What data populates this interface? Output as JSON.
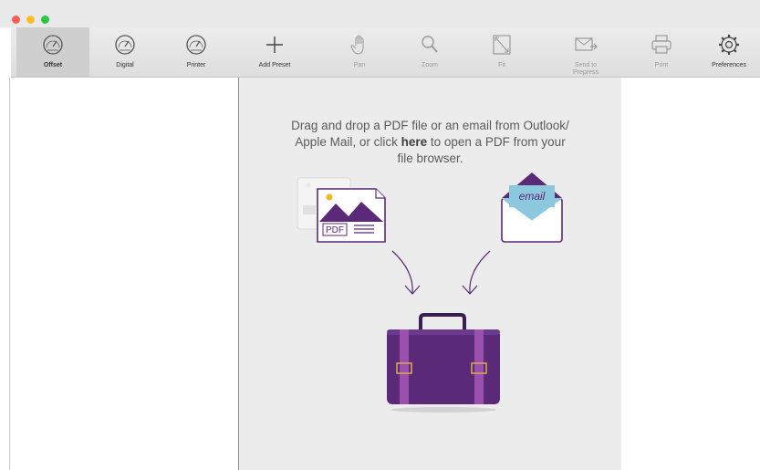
{
  "window": {
    "traffic_lights": [
      "close",
      "minimize",
      "zoom"
    ]
  },
  "toolbar": {
    "items": [
      {
        "label": "Offset",
        "icon": "gauge-icon",
        "selected": true,
        "enabled": true
      },
      {
        "label": "Digital",
        "icon": "gauge-icon",
        "selected": false,
        "enabled": true
      },
      {
        "label": "Printer",
        "icon": "gauge-icon",
        "selected": false,
        "enabled": true
      },
      {
        "label": "Add Preset",
        "icon": "plus-icon",
        "selected": false,
        "enabled": true
      },
      {
        "label": "Pan",
        "icon": "hand-icon",
        "selected": false,
        "enabled": false
      },
      {
        "label": "Zoom",
        "icon": "magnifier-icon",
        "selected": false,
        "enabled": false
      },
      {
        "label": "Fit",
        "icon": "fit-icon",
        "selected": false,
        "enabled": false
      },
      {
        "label": "Send to Prepress",
        "label_line1": "Send to",
        "label_line2": "Prepress",
        "icon": "send-envelope-icon",
        "selected": false,
        "enabled": false
      },
      {
        "label": "Print",
        "icon": "printer-icon",
        "selected": false,
        "enabled": false
      },
      {
        "label": "Preferences",
        "icon": "gear-icon",
        "selected": false,
        "enabled": true
      }
    ]
  },
  "dropzone": {
    "line1": "Drag and drop a PDF file or an email from Outlook/",
    "line2_before": "Apple Mail, or click ",
    "line2_link": "here",
    "line2_after": " to open a PDF from your",
    "line3": "file browser.",
    "pdf_badge": "PDF",
    "email_badge": "email"
  },
  "colors": {
    "accent_purple": "#5a2a78",
    "stripe_purple": "#9b4fae",
    "email_blue": "#8cc9de",
    "buckle_gold": "#d7a64b"
  }
}
